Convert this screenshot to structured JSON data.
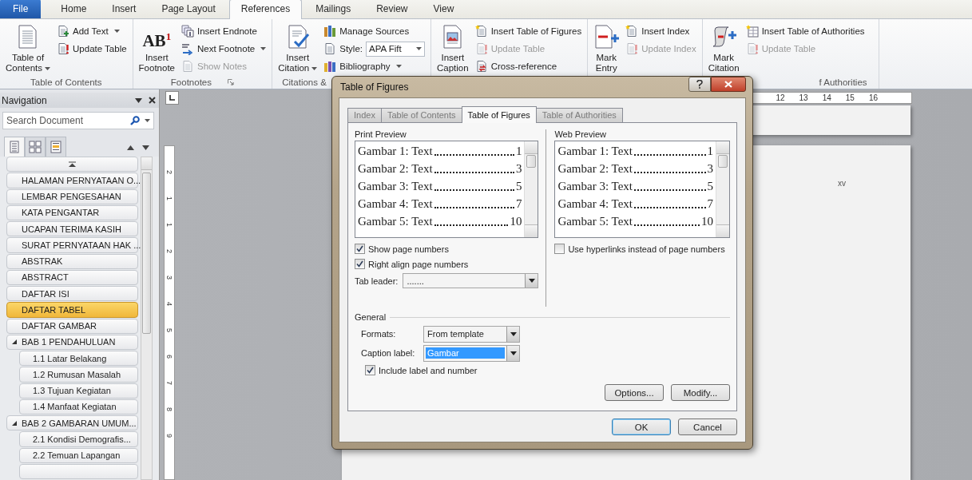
{
  "ribbon_tabs": [
    {
      "label": "File",
      "kind": "file",
      "selected": false
    },
    {
      "label": "Home",
      "kind": "tab",
      "selected": false
    },
    {
      "label": "Insert",
      "kind": "tab",
      "selected": false
    },
    {
      "label": "Page Layout",
      "kind": "tab",
      "selected": false
    },
    {
      "label": "References",
      "kind": "tab",
      "selected": true
    },
    {
      "label": "Mailings",
      "kind": "tab",
      "selected": false
    },
    {
      "label": "Review",
      "kind": "tab",
      "selected": false
    },
    {
      "label": "View",
      "kind": "tab",
      "selected": false
    }
  ],
  "ribbon_groups": [
    {
      "label": "Table of Contents",
      "large": [
        {
          "label": "Table of\nContents",
          "dropdown": true
        }
      ],
      "small": [
        {
          "kind": "button",
          "label": "Add Text",
          "dropdown": true,
          "disabled": false
        },
        {
          "kind": "button",
          "label": "Update Table",
          "disabled": false
        }
      ]
    },
    {
      "label": "Footnotes",
      "launcher": true,
      "large": [
        {
          "label": "Insert\nFootnote",
          "icon_text": "AB$^{1}$"
        }
      ],
      "small": [
        {
          "kind": "button",
          "label": "Insert Endnote",
          "disabled": false
        },
        {
          "kind": "button",
          "label": "Next Footnote",
          "dropdown": true,
          "disabled": false
        },
        {
          "kind": "button",
          "label": "Show Notes",
          "disabled": true
        }
      ]
    },
    {
      "label": "Citations &",
      "large": [
        {
          "label": "Insert\nCitation",
          "dropdown": true
        }
      ],
      "small": [
        {
          "kind": "button",
          "label": "Manage Sources",
          "disabled": false
        },
        {
          "kind": "select",
          "label": "Style:",
          "value": "APA Fift"
        },
        {
          "kind": "button",
          "label": "Bibliography",
          "dropdown": true,
          "disabled": false
        }
      ]
    },
    {
      "large": [
        {
          "label": "Insert\nCaption"
        }
      ],
      "small": [
        {
          "kind": "button",
          "label": "Insert Table of Figures",
          "disabled": false
        },
        {
          "kind": "button",
          "label": "Update Table",
          "disabled": true
        },
        {
          "kind": "button",
          "label": "Cross-reference",
          "disabled": false
        }
      ]
    },
    {
      "large": [
        {
          "label": "Mark\nEntry"
        }
      ],
      "small": [
        {
          "kind": "button",
          "label": "Insert Index",
          "disabled": false
        },
        {
          "kind": "button",
          "label": "Update Index",
          "disabled": true
        }
      ]
    },
    {
      "label": "f Authorities",
      "large": [
        {
          "label": "Mark\nCitation"
        }
      ],
      "small": [
        {
          "kind": "button",
          "label": "Insert Table of Authorities",
          "disabled": false
        },
        {
          "kind": "button",
          "label": "Update Table",
          "disabled": true
        }
      ]
    }
  ],
  "navigation": {
    "title": "Navigation",
    "search_placeholder": "Search Document",
    "view_tabs": [
      {
        "selected": true
      },
      {
        "selected": false
      },
      {
        "selected": false
      }
    ],
    "headings": [
      {
        "label": "HALAMAN PERNYATAAN O...",
        "selected": false,
        "expanded": false
      },
      {
        "label": "LEMBAR PENGESAHAN",
        "selected": false,
        "expanded": false
      },
      {
        "label": "KATA PENGANTAR",
        "selected": false,
        "expanded": false
      },
      {
        "label": "UCAPAN TERIMA KASIH",
        "selected": false,
        "expanded": false
      },
      {
        "label": "SURAT PERNYATAAN HAK ...",
        "selected": false,
        "expanded": false
      },
      {
        "label": "ABSTRAK",
        "selected": false,
        "expanded": false
      },
      {
        "label": "ABSTRACT",
        "selected": false,
        "expanded": false
      },
      {
        "label": "DAFTAR ISI",
        "selected": false,
        "expanded": false
      },
      {
        "label": "DAFTAR TABEL",
        "selected": true,
        "expanded": false
      },
      {
        "label": "DAFTAR GAMBAR",
        "selected": false,
        "expanded": false
      },
      {
        "label": "BAB 1  PENDAHULUAN",
        "selected": false,
        "expanded": true,
        "children": [
          {
            "label": "1.1 Latar Belakang",
            "selected": false
          },
          {
            "label": "1.2 Rumusan Masalah",
            "selected": false
          },
          {
            "label": "1.3 Tujuan Kegiatan",
            "selected": false
          },
          {
            "label": "1.4 Manfaat Kegiatan",
            "selected": false
          }
        ]
      },
      {
        "label": "BAB 2 GAMBARAN UMUM...",
        "selected": false,
        "expanded": true,
        "children": [
          {
            "label": "2.1 Kondisi Demografis...",
            "selected": false
          },
          {
            "label": "2.2 Temuan Lapangan",
            "selected": false
          }
        ]
      }
    ]
  },
  "document": {
    "ruler_labels": [
      "12",
      "13",
      "14",
      "15",
      "16"
    ],
    "vertical_ruler_labels": [
      "2",
      "1",
      "1",
      "2",
      "3",
      "4",
      "5",
      "6",
      "7",
      "8",
      "9"
    ],
    "page_number": "xv"
  },
  "dialog": {
    "title": "Table of Figures",
    "tabs": [
      {
        "label": "Index",
        "selected": false
      },
      {
        "label": "Table of Contents",
        "selected": false
      },
      {
        "label": "Table of Figures",
        "selected": true
      },
      {
        "label": "Table of Authorities",
        "selected": false
      }
    ],
    "print_preview": {
      "label": "Print Preview",
      "entries": [
        {
          "text": "Gambar 1: Text",
          "page": "1"
        },
        {
          "text": "Gambar 2: Text",
          "page": "3"
        },
        {
          "text": "Gambar 3: Text",
          "page": "5"
        },
        {
          "text": "Gambar 4: Text",
          "page": "7"
        },
        {
          "text": "Gambar 5: Text",
          "page": "10"
        }
      ]
    },
    "web_preview": {
      "label": "Web Preview",
      "entries": [
        {
          "text": "Gambar 1: Text",
          "page": "1"
        },
        {
          "text": "Gambar 2: Text",
          "page": "3"
        },
        {
          "text": "Gambar 3: Text",
          "page": "5"
        },
        {
          "text": "Gambar 4: Text",
          "page": "7"
        },
        {
          "text": "Gambar 5: Text",
          "page": "10"
        }
      ]
    },
    "show_page_numbers": {
      "label": "Show page numbers",
      "checked": true
    },
    "right_align": {
      "label": "Right align page numbers",
      "checked": true
    },
    "tab_leader": {
      "label": "Tab leader:",
      "value": "......."
    },
    "use_hyperlinks": {
      "label": "Use hyperlinks instead of page numbers",
      "checked": false
    },
    "general": {
      "label": "General",
      "formats": {
        "label": "Formats:",
        "value": "From template"
      },
      "caption_label": {
        "label": "Caption label:",
        "value": "Gambar",
        "selected": true
      },
      "include_label": {
        "label": "Include label and number",
        "checked": true
      }
    },
    "buttons": [
      {
        "label": "Options...",
        "default": false
      },
      {
        "label": "Modify...",
        "default": false
      }
    ],
    "footer_buttons": [
      {
        "label": "OK",
        "default": true
      },
      {
        "label": "Cancel",
        "default": false
      }
    ]
  }
}
